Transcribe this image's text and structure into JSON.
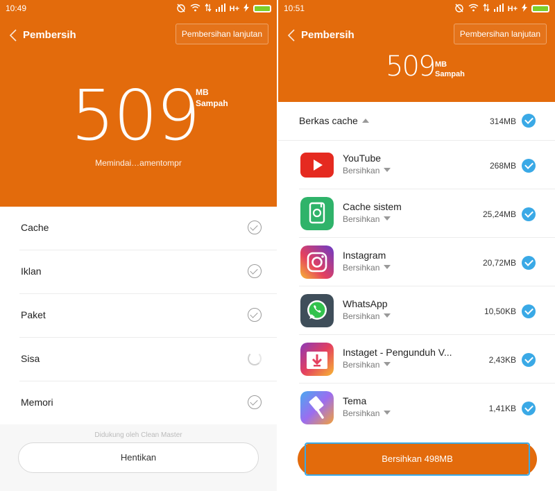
{
  "left": {
    "time": "10:49",
    "title": "Pembersih",
    "advanced_button": "Pembersihan lanjutan",
    "junk_amount": "509",
    "junk_unit": "MB",
    "junk_label": "Sampah",
    "scan_status": "Memindai…amentompr",
    "categories": [
      {
        "label": "Cache",
        "state": "done"
      },
      {
        "label": "Iklan",
        "state": "done"
      },
      {
        "label": "Paket",
        "state": "done"
      },
      {
        "label": "Sisa",
        "state": "scanning"
      },
      {
        "label": "Memori",
        "state": "done"
      }
    ],
    "powered_by": "Didukung oleh Clean Master",
    "stop_button": "Hentikan"
  },
  "right": {
    "time": "10:51",
    "title": "Pembersih",
    "advanced_button": "Pembersihan lanjutan",
    "junk_amount": "509",
    "junk_unit": "MB",
    "junk_label": "Sampah",
    "cache_section": {
      "label": "Berkas cache",
      "size": "314MB"
    },
    "apps": [
      {
        "name": "YouTube",
        "action": "Bersihkan",
        "size": "268MB",
        "icon": "youtube-icon"
      },
      {
        "name": "Cache sistem",
        "action": "Bersihkan",
        "size": "25,24MB",
        "icon": "system-cache-icon"
      },
      {
        "name": "Instagram",
        "action": "Bersihkan",
        "size": "20,72MB",
        "icon": "instagram-icon"
      },
      {
        "name": "WhatsApp",
        "action": "Bersihkan",
        "size": "10,50KB",
        "icon": "whatsapp-icon"
      },
      {
        "name": "Instaget - Pengunduh V...",
        "action": "Bersihkan",
        "size": "2,43KB",
        "icon": "instaget-icon"
      },
      {
        "name": "Tema",
        "action": "Bersihkan",
        "size": "1,41KB",
        "icon": "theme-icon"
      }
    ],
    "clean_button": "Bersihkan 498MB"
  },
  "status_bar": {
    "network": "H+"
  },
  "colors": {
    "accent_orange": "#e36b0c",
    "check_blue": "#3aa9e6",
    "battery_green": "#7ccf2a"
  }
}
